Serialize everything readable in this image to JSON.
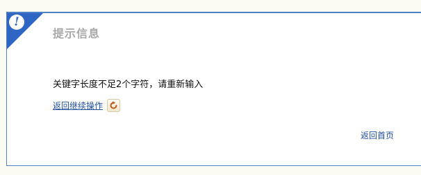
{
  "notice": {
    "icon_glyph": "!",
    "icon_name": "exclamation-icon",
    "title": "提示信息",
    "message": "关键字长度不足2个字符，请重新输入",
    "back_link": "返回继续操作",
    "back_button_icon": "refresh-arrow-icon",
    "home_link": "返回首页"
  },
  "colors": {
    "accent": "#2f66c4",
    "border": "#4f7fc6",
    "link": "#1f4f9e",
    "title": "#a8a8a8",
    "page_background": "#fbfbf3"
  }
}
